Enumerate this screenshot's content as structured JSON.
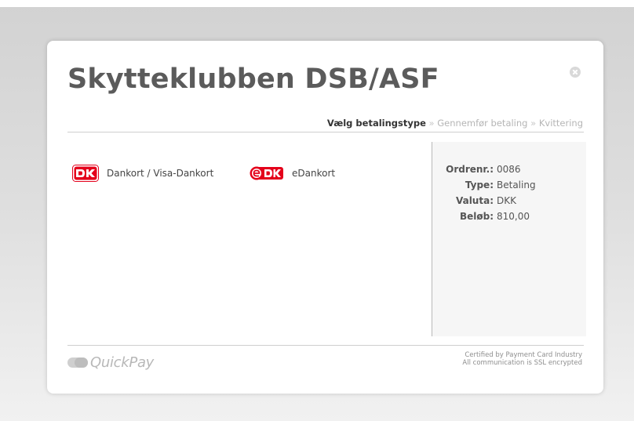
{
  "modal": {
    "title": "Skytteklubben DSB/ASF",
    "close_icon": "close-icon"
  },
  "steps": {
    "active": "Vælg betalingstype",
    "separator": "»",
    "step2": "Gennemfør betaling",
    "step3": "Kvittering"
  },
  "payment_methods": [
    {
      "label": "Dankort / Visa-Dankort",
      "icon": "dankort-logo-icon"
    },
    {
      "label": "eDankort",
      "icon": "edankort-logo-icon"
    }
  ],
  "order": {
    "fields": [
      {
        "key": "Ordrenr.:",
        "value": "0086"
      },
      {
        "key": "Type:",
        "value": "Betaling"
      },
      {
        "key": "Valuta:",
        "value": "DKK"
      },
      {
        "key": "Beløb:",
        "value": "810,00"
      }
    ]
  },
  "footer": {
    "brand": "QuickPay",
    "cert_line1": "Certified by Payment Card Industry",
    "cert_line2": "All communication is SSL encrypted"
  },
  "colors": {
    "dankort_red": "#e4001b",
    "title_gray": "#5b5b5b"
  }
}
